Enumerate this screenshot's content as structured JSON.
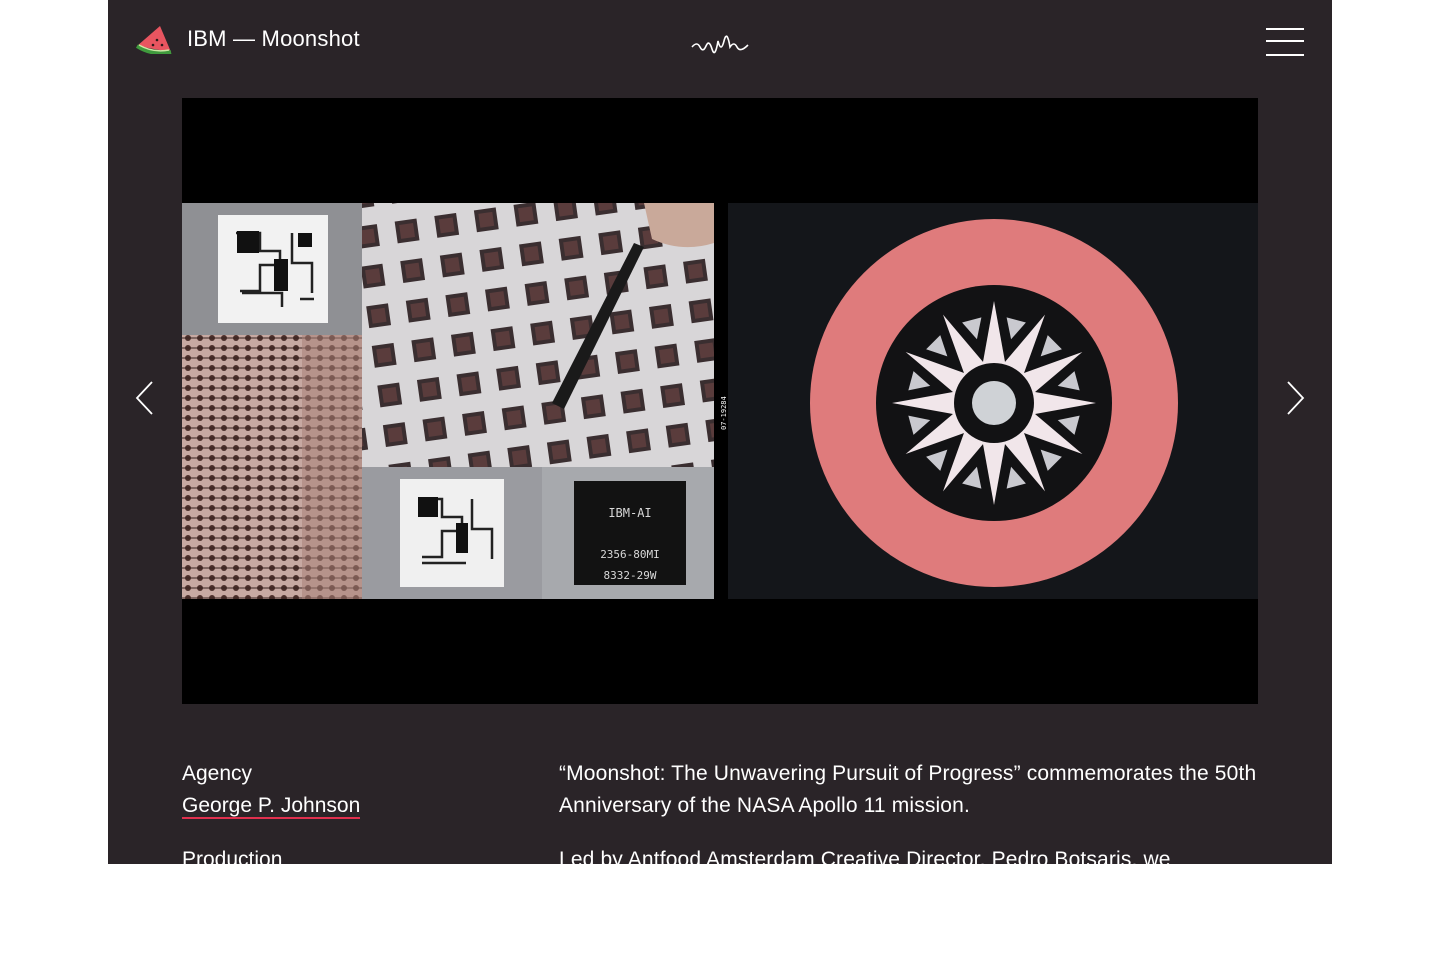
{
  "header": {
    "title": "IBM — Moonshot",
    "logo_icon": "watermelon-slice-icon",
    "sound_icon": "sound-wave-icon",
    "menu_icon": "hamburger-menu-icon"
  },
  "media": {
    "film_code": "07-19284",
    "chip_label_lines": [
      "IBM-AI",
      "2356-80MI",
      "8332-29W"
    ],
    "prev_icon": "chevron-left-icon",
    "next_icon": "chevron-right-icon"
  },
  "credits": {
    "agency_label": "Agency",
    "agency_name": "George P. Johnson",
    "production_label": "Production"
  },
  "description": {
    "paragraph1": "“Moonshot: The Unwavering Pursuit of Progress” commemorates the 50th Anniversary of the NASA Apollo 11 mission.",
    "paragraph2": "Led by Antfood Amsterdam Creative Director, Pedro Botsaris, we"
  },
  "colors": {
    "page_bg": "#ffffff",
    "panel_bg": "#2a2428",
    "accent_underline": "#e0304e",
    "emblem_ring": "#e0787a"
  }
}
